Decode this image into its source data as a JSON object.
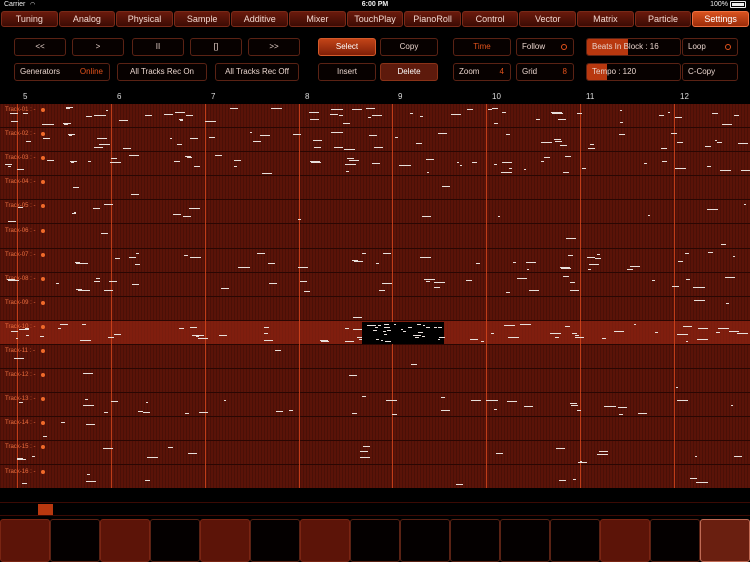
{
  "status": {
    "carrier": "Carrier",
    "time": "6:00 PM",
    "battery": "100%"
  },
  "tabs": [
    {
      "label": "Tuning",
      "active": false
    },
    {
      "label": "Analog",
      "active": false
    },
    {
      "label": "Physical",
      "active": false
    },
    {
      "label": "Sample",
      "active": false
    },
    {
      "label": "Additive",
      "active": false
    },
    {
      "label": "Mixer",
      "active": false
    },
    {
      "label": "TouchPlay",
      "active": false
    },
    {
      "label": "PianoRoll",
      "active": false
    },
    {
      "label": "Control",
      "active": false
    },
    {
      "label": "Vector",
      "active": false
    },
    {
      "label": "Matrix",
      "active": false
    },
    {
      "label": "Particle",
      "active": false
    },
    {
      "label": "Settings",
      "active": true
    }
  ],
  "transport": {
    "rewind": "<<",
    "play": ">",
    "pause": "II",
    "stop": "[]",
    "forward": ">>"
  },
  "generators": {
    "label": "Generators",
    "value": "Online"
  },
  "rec": {
    "all_on": "All Tracks Rec On",
    "all_off": "All Tracks Rec Off"
  },
  "edit": {
    "select": "Select",
    "copy": "Copy",
    "insert": "Insert",
    "delete": "Delete"
  },
  "view": {
    "time": "Time",
    "follow": "Follow",
    "zoom_label": "Zoom",
    "zoom_value": "4",
    "grid_label": "Grid",
    "grid_value": "8"
  },
  "block": {
    "beats_label": "Beats In Block : 16",
    "beats_fraction": 0.44,
    "loop": "Loop",
    "tempo_label": "Tempo : 120",
    "tempo_fraction": 0.22,
    "ccopy": "C-Copy"
  },
  "ruler": [
    "5",
    "6",
    "7",
    "8",
    "9",
    "10",
    "11",
    "12"
  ],
  "tracks": [
    "Track-01 : -",
    "Track-02 : -",
    "Track-03 : -",
    "Track-04 : -",
    "Track-05 : -",
    "Track-06 : -",
    "Track-07 : -",
    "Track-08 : -",
    "Track-09 : -",
    "Track-10 : -",
    "Track-11 : -",
    "Track-12 : -",
    "Track-13 : -",
    "Track-14 : -",
    "Track-15 : -",
    "Track-16 : -"
  ],
  "selected_track": 9,
  "scroll_position": 0.05,
  "pads": [
    "red",
    "dark",
    "red",
    "dark",
    "red",
    "dark",
    "red",
    "dark",
    "dark",
    "dark",
    "dark",
    "dark",
    "red",
    "dark",
    "pale"
  ],
  "colors": {
    "accent": "#e2521b",
    "grid_bg": "#5a1308",
    "note": "#e8e0dc"
  }
}
